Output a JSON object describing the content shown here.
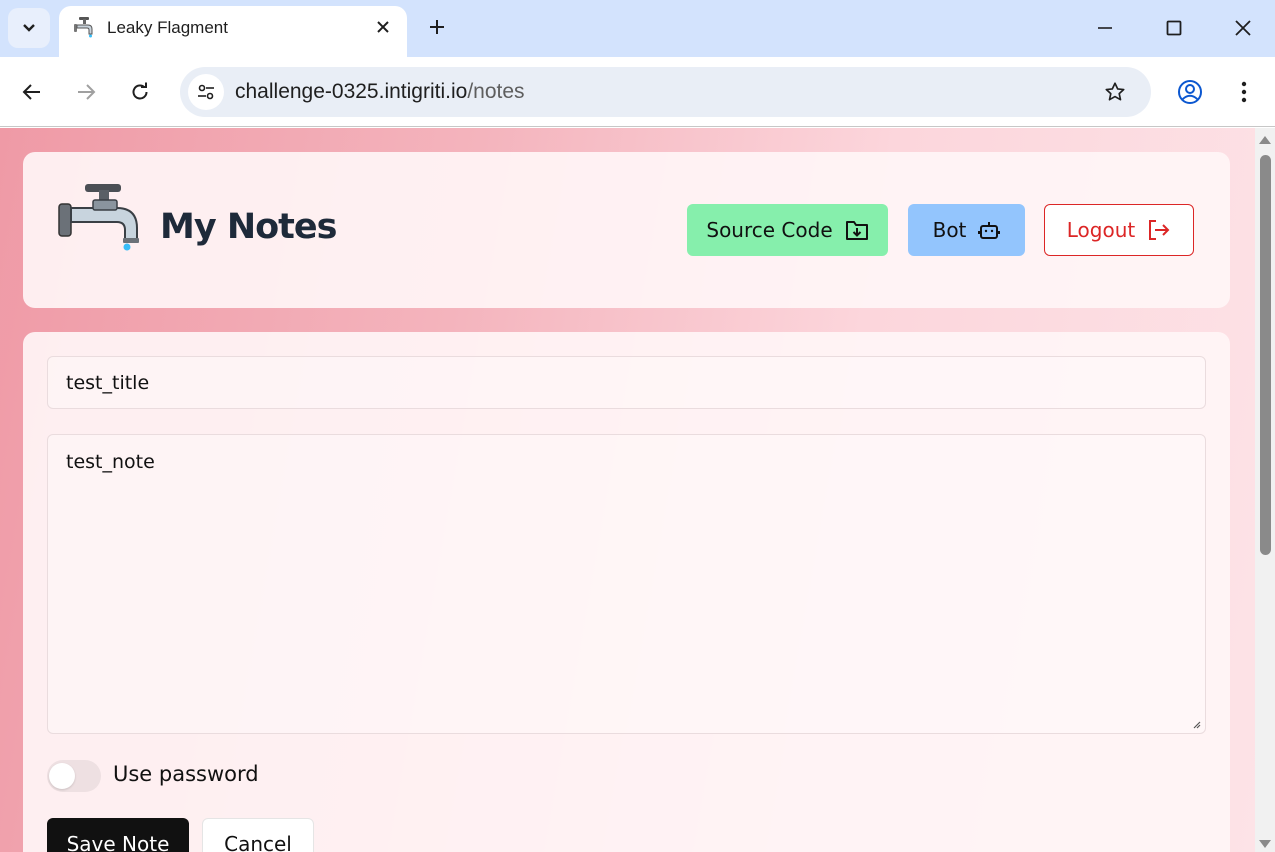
{
  "browser": {
    "tab_title": "Leaky Flagment",
    "url_host": "challenge-0325.intigriti.io",
    "url_path": "/notes"
  },
  "header": {
    "app_title": "My Notes",
    "source_code_label": "Source Code",
    "bot_label": "Bot",
    "logout_label": "Logout"
  },
  "form": {
    "title_value": "test_title",
    "note_value": "test_note",
    "use_password_label": "Use password",
    "use_password_enabled": false,
    "save_label": "Save Note",
    "cancel_label": "Cancel"
  },
  "colors": {
    "source_button": "#86efac",
    "bot_button": "#93c5fd",
    "logout_accent": "#dc2626",
    "save_button": "#111111"
  },
  "icons": [
    "chevron-down-icon",
    "faucet-icon",
    "close-icon",
    "plus-icon",
    "minimize-icon",
    "maximize-icon",
    "window-close-icon",
    "back-arrow-icon",
    "forward-arrow-icon",
    "reload-icon",
    "site-settings-icon",
    "star-icon",
    "profile-icon",
    "kebab-menu-icon",
    "folder-download-icon",
    "robot-icon",
    "logout-icon"
  ]
}
